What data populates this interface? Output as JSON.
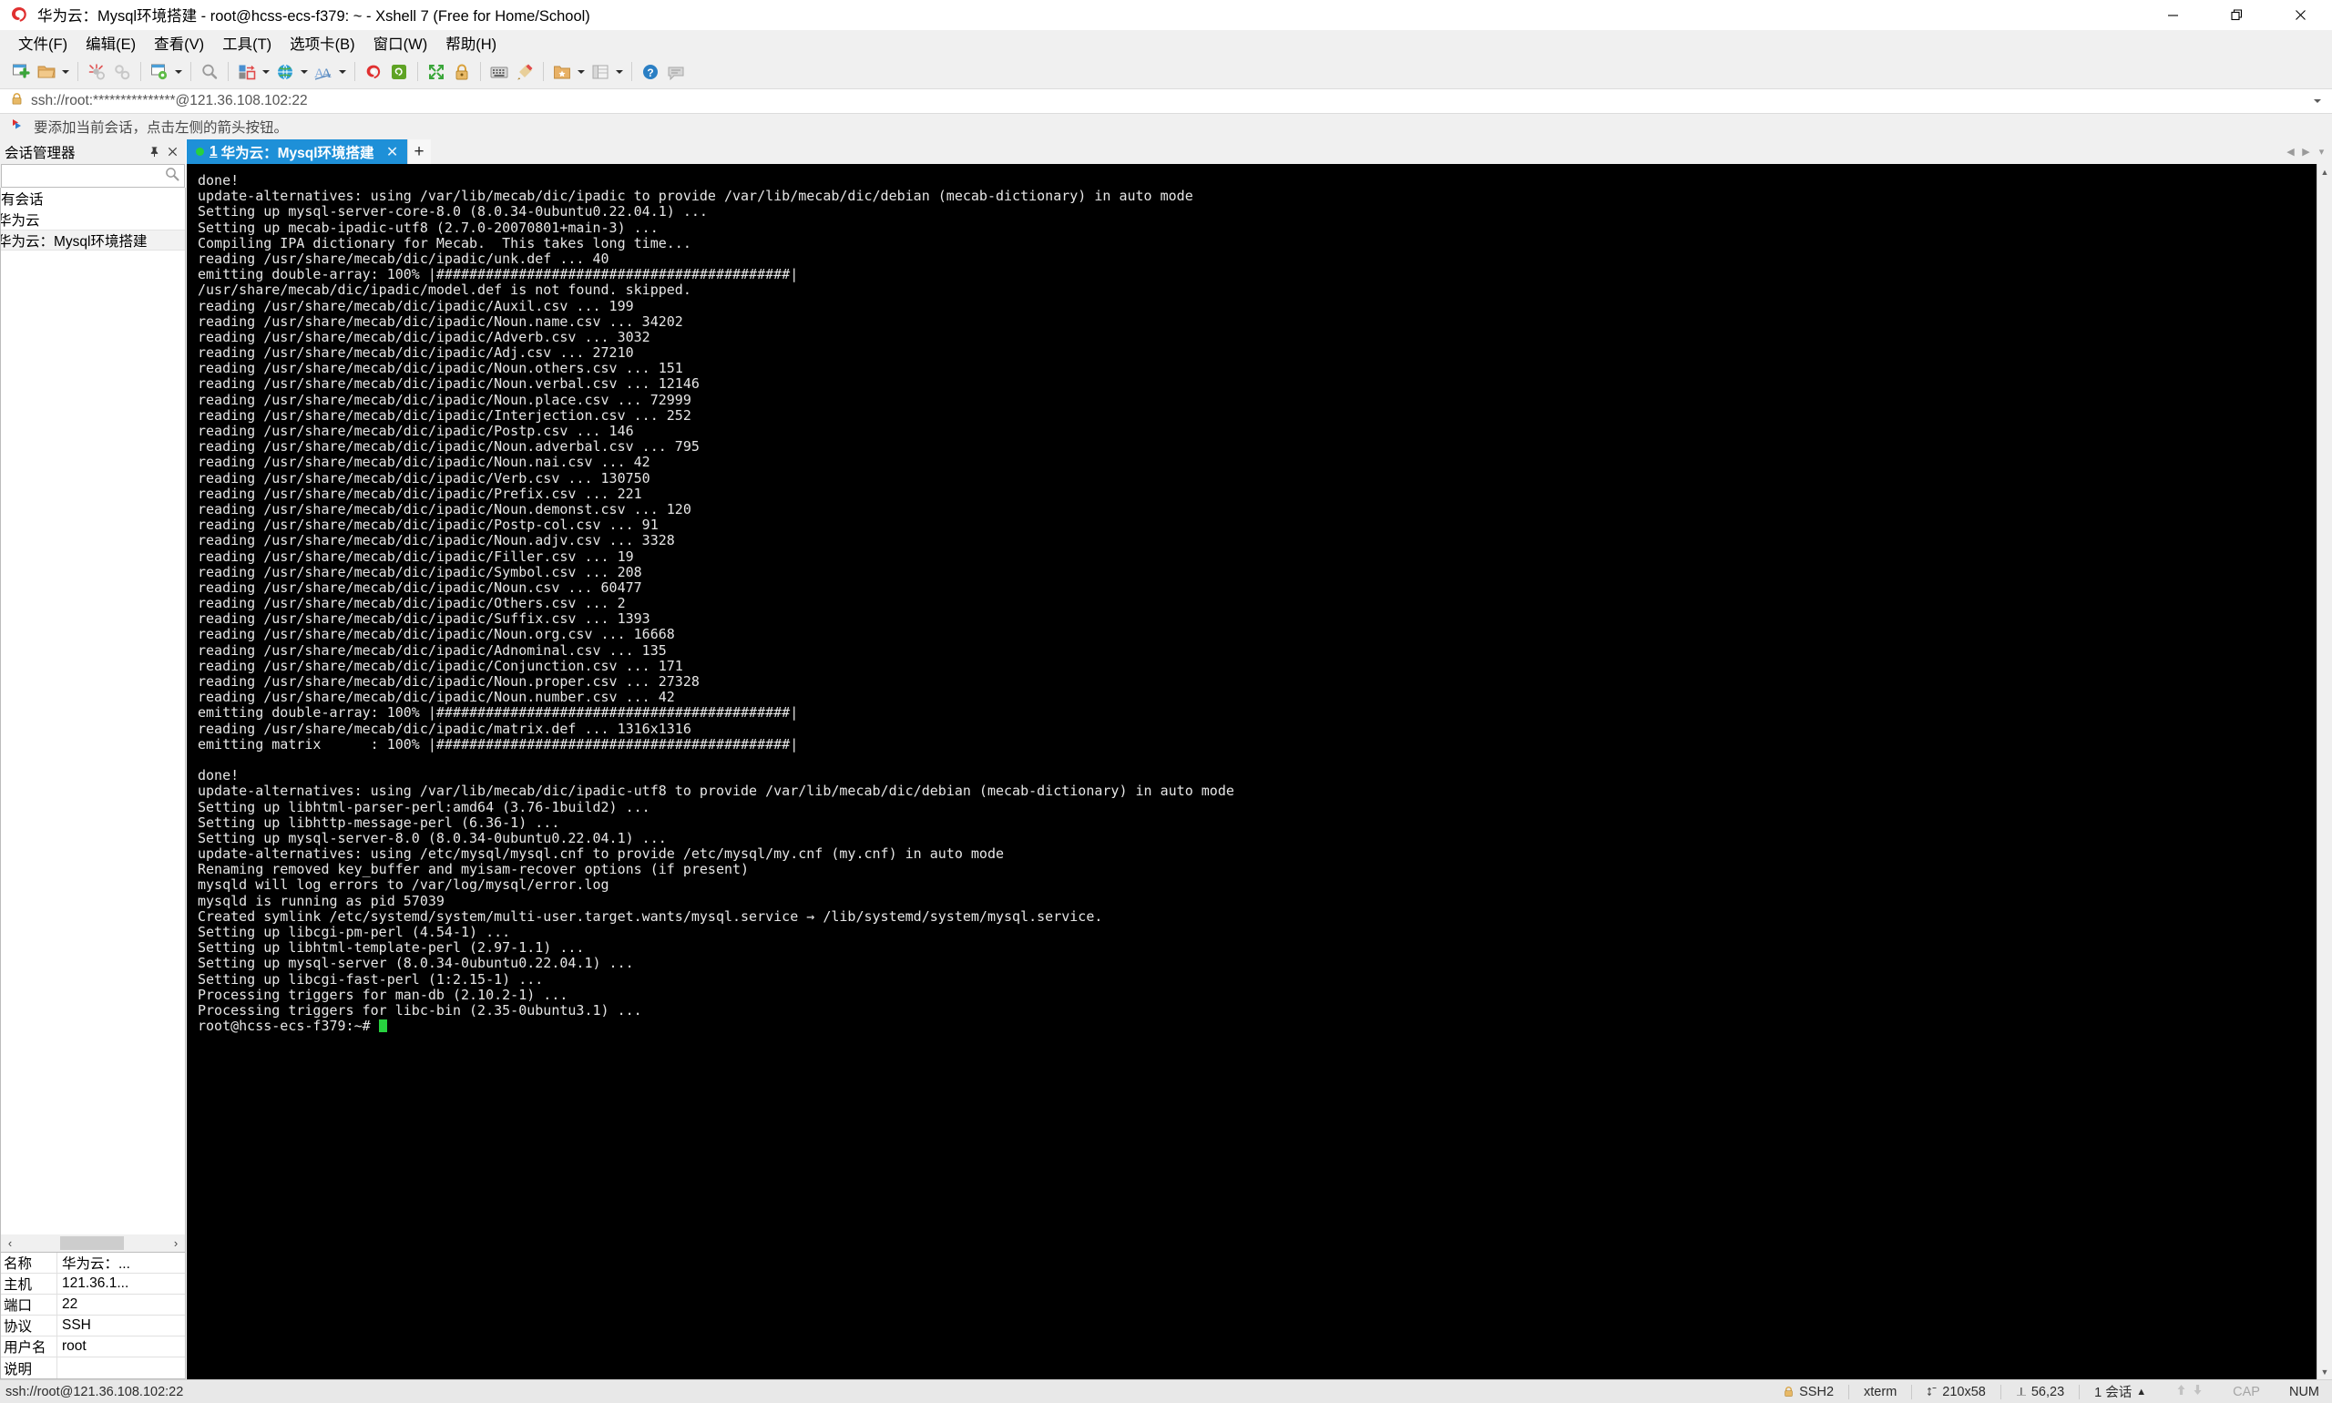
{
  "window": {
    "title": "华为云：Mysql环境搭建 - root@hcss-ecs-f379: ~ - Xshell 7 (Free for Home/School)",
    "minimize_label": "—",
    "maximize_label": "❐",
    "close_label": "✕"
  },
  "menu": {
    "items": [
      {
        "label": "文件(F)"
      },
      {
        "label": "编辑(E)"
      },
      {
        "label": "查看(V)"
      },
      {
        "label": "工具(T)"
      },
      {
        "label": "选项卡(B)"
      },
      {
        "label": "窗口(W)"
      },
      {
        "label": "帮助(H)"
      }
    ]
  },
  "toolbar": {
    "buttons": [
      {
        "name": "new-session-icon"
      },
      {
        "name": "open-session-icon"
      },
      {
        "name": "disconnect-icon"
      },
      {
        "name": "reconnect-icon"
      },
      {
        "name": "session-properties-icon"
      },
      {
        "name": "find-icon"
      },
      {
        "name": "transfer-file-icon"
      },
      {
        "name": "web-browser-icon"
      },
      {
        "name": "font-icon"
      },
      {
        "name": "xshell-logo-icon"
      },
      {
        "name": "xftp-icon"
      },
      {
        "name": "fullscreen-icon"
      },
      {
        "name": "lock-icon"
      },
      {
        "name": "keyboard-icon"
      },
      {
        "name": "highlight-icon"
      },
      {
        "name": "folder-star-icon"
      },
      {
        "name": "layout-icon"
      },
      {
        "name": "help-icon"
      },
      {
        "name": "comment-icon"
      }
    ]
  },
  "address_bar": {
    "url": "ssh://root:***************@121.36.108.102:22",
    "lock_icon": "lock-icon"
  },
  "notification": {
    "icon": "flag-icon",
    "text": "要添加当前会话，点击左侧的箭头按钮。"
  },
  "sidebar": {
    "title": "会话管理器",
    "pin_label": "📌",
    "close_label": "✕",
    "search": {
      "value": "",
      "placeholder": ""
    },
    "tree": [
      {
        "label": "有会话",
        "selected": false
      },
      {
        "label": "华为云",
        "selected": false
      },
      {
        "label": "华为云：Mysql环境搭建",
        "selected": true
      }
    ],
    "hscroll": {
      "left_label": "‹",
      "right_label": "›"
    },
    "properties": [
      {
        "key": "名称",
        "value": "华为云：..."
      },
      {
        "key": "主机",
        "value": "121.36.1..."
      },
      {
        "key": "端口",
        "value": "22"
      },
      {
        "key": "协议",
        "value": "SSH"
      },
      {
        "key": "用户名",
        "value": "root"
      },
      {
        "key": "说明",
        "value": ""
      }
    ]
  },
  "tabs": {
    "items": [
      {
        "number": "1",
        "label": "华为云：Mysql环境搭建",
        "active": true,
        "close_label": "✕"
      }
    ],
    "new_tab_label": "+",
    "scroll_left": "◀",
    "scroll_right": "▶",
    "list_label": "▾"
  },
  "terminal": {
    "prompt": "root@hcss-ecs-f379:~#",
    "lines": [
      "done!",
      "update-alternatives: using /var/lib/mecab/dic/ipadic to provide /var/lib/mecab/dic/debian (mecab-dictionary) in auto mode",
      "Setting up mysql-server-core-8.0 (8.0.34-0ubuntu0.22.04.1) ...",
      "Setting up mecab-ipadic-utf8 (2.7.0-20070801+main-3) ...",
      "Compiling IPA dictionary for Mecab.  This takes long time...",
      "reading /usr/share/mecab/dic/ipadic/unk.def ... 40",
      "emitting double-array: 100% |###########################################|",
      "/usr/share/mecab/dic/ipadic/model.def is not found. skipped.",
      "reading /usr/share/mecab/dic/ipadic/Auxil.csv ... 199",
      "reading /usr/share/mecab/dic/ipadic/Noun.name.csv ... 34202",
      "reading /usr/share/mecab/dic/ipadic/Adverb.csv ... 3032",
      "reading /usr/share/mecab/dic/ipadic/Adj.csv ... 27210",
      "reading /usr/share/mecab/dic/ipadic/Noun.others.csv ... 151",
      "reading /usr/share/mecab/dic/ipadic/Noun.verbal.csv ... 12146",
      "reading /usr/share/mecab/dic/ipadic/Noun.place.csv ... 72999",
      "reading /usr/share/mecab/dic/ipadic/Interjection.csv ... 252",
      "reading /usr/share/mecab/dic/ipadic/Postp.csv ... 146",
      "reading /usr/share/mecab/dic/ipadic/Noun.adverbal.csv ... 795",
      "reading /usr/share/mecab/dic/ipadic/Noun.nai.csv ... 42",
      "reading /usr/share/mecab/dic/ipadic/Verb.csv ... 130750",
      "reading /usr/share/mecab/dic/ipadic/Prefix.csv ... 221",
      "reading /usr/share/mecab/dic/ipadic/Noun.demonst.csv ... 120",
      "reading /usr/share/mecab/dic/ipadic/Postp-col.csv ... 91",
      "reading /usr/share/mecab/dic/ipadic/Noun.adjv.csv ... 3328",
      "reading /usr/share/mecab/dic/ipadic/Filler.csv ... 19",
      "reading /usr/share/mecab/dic/ipadic/Symbol.csv ... 208",
      "reading /usr/share/mecab/dic/ipadic/Noun.csv ... 60477",
      "reading /usr/share/mecab/dic/ipadic/Others.csv ... 2",
      "reading /usr/share/mecab/dic/ipadic/Suffix.csv ... 1393",
      "reading /usr/share/mecab/dic/ipadic/Noun.org.csv ... 16668",
      "reading /usr/share/mecab/dic/ipadic/Adnominal.csv ... 135",
      "reading /usr/share/mecab/dic/ipadic/Conjunction.csv ... 171",
      "reading /usr/share/mecab/dic/ipadic/Noun.proper.csv ... 27328",
      "reading /usr/share/mecab/dic/ipadic/Noun.number.csv ... 42",
      "emitting double-array: 100% |###########################################|",
      "reading /usr/share/mecab/dic/ipadic/matrix.def ... 1316x1316",
      "emitting matrix      : 100% |###########################################|",
      "",
      "done!",
      "update-alternatives: using /var/lib/mecab/dic/ipadic-utf8 to provide /var/lib/mecab/dic/debian (mecab-dictionary) in auto mode",
      "Setting up libhtml-parser-perl:amd64 (3.76-1build2) ...",
      "Setting up libhttp-message-perl (6.36-1) ...",
      "Setting up mysql-server-8.0 (8.0.34-0ubuntu0.22.04.1) ...",
      "update-alternatives: using /etc/mysql/mysql.cnf to provide /etc/mysql/my.cnf (my.cnf) in auto mode",
      "Renaming removed key_buffer and myisam-recover options (if present)",
      "mysqld will log errors to /var/log/mysql/error.log",
      "mysqld is running as pid 57039",
      "Created symlink /etc/systemd/system/multi-user.target.wants/mysql.service → /lib/systemd/system/mysql.service.",
      "Setting up libcgi-pm-perl (4.54-1) ...",
      "Setting up libhtml-template-perl (2.97-1.1) ...",
      "Setting up mysql-server (8.0.34-0ubuntu0.22.04.1) ...",
      "Setting up libcgi-fast-perl (1:2.15-1) ...",
      "Processing triggers for man-db (2.10.2-1) ...",
      "Processing triggers for libc-bin (2.35-0ubuntu3.1) ..."
    ]
  },
  "status_bar": {
    "left": "ssh://root@121.36.108.102:22",
    "protocol": "SSH2",
    "terminal_type": "xterm",
    "size": "210x58",
    "cursor": "56,23",
    "sessions": "1 会话",
    "sessions_caret": "▲",
    "upload_icon": "arrow-up-icon",
    "download_icon": "arrow-down-icon",
    "caps": "CAP",
    "num": "NUM"
  },
  "colors": {
    "accent": "#1e90d8",
    "terminal_bg": "#000000",
    "terminal_fg": "#e6e6e6",
    "cursor": "#27d13f",
    "chrome": "#f0f0f0"
  }
}
